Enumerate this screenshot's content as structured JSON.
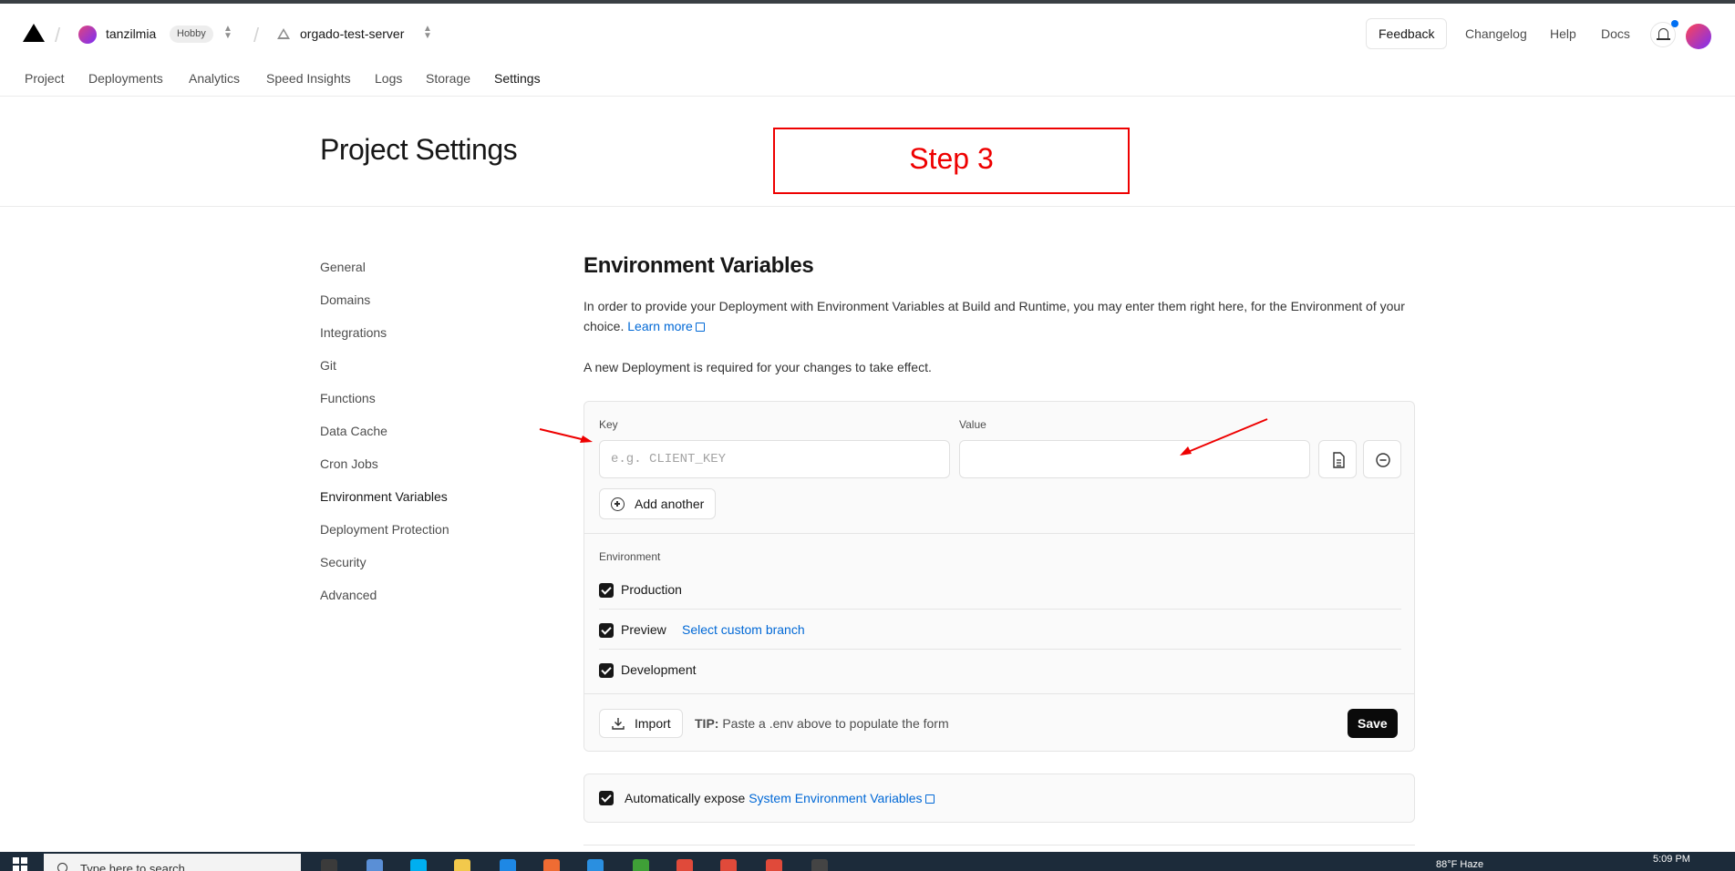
{
  "header": {
    "team_name": "tanzilmia",
    "plan_badge": "Hobby",
    "project_name": "orgado-test-server",
    "feedback_label": "Feedback",
    "changelog_label": "Changelog",
    "help_label": "Help",
    "docs_label": "Docs"
  },
  "tabs": [
    {
      "label": "Project"
    },
    {
      "label": "Deployments"
    },
    {
      "label": "Analytics"
    },
    {
      "label": "Speed Insights"
    },
    {
      "label": "Logs"
    },
    {
      "label": "Storage"
    },
    {
      "label": "Settings",
      "active": true
    }
  ],
  "page": {
    "title": "Project Settings",
    "annotation": "Step 3"
  },
  "sidebar": {
    "items": [
      {
        "label": "General"
      },
      {
        "label": "Domains"
      },
      {
        "label": "Integrations"
      },
      {
        "label": "Git"
      },
      {
        "label": "Functions"
      },
      {
        "label": "Data Cache"
      },
      {
        "label": "Cron Jobs"
      },
      {
        "label": "Environment Variables",
        "active": true
      },
      {
        "label": "Deployment Protection"
      },
      {
        "label": "Security"
      },
      {
        "label": "Advanced"
      }
    ]
  },
  "env": {
    "title": "Environment Variables",
    "description": "In order to provide your Deployment with Environment Variables at Build and Runtime, you may enter them right here, for the Environment of your choice.",
    "learn_more": "Learn more",
    "notice": "A new Deployment is required for your changes to take effect.",
    "key_label": "Key",
    "key_placeholder": "e.g. CLIENT_KEY",
    "key_value": "",
    "value_label": "Value",
    "value_value": "",
    "add_another": "Add another",
    "environment_label": "Environment",
    "environments": [
      {
        "label": "Production",
        "checked": true
      },
      {
        "label": "Preview",
        "checked": true,
        "link": "Select custom branch"
      },
      {
        "label": "Development",
        "checked": true
      }
    ],
    "import_label": "Import",
    "tip_prefix": "TIP:",
    "tip_text": "Paste a .env above to populate the form",
    "save_label": "Save",
    "expose_text": "Automatically expose",
    "expose_link": "System Environment Variables"
  },
  "colors": {
    "accent_link": "#0068d6",
    "annotation_red": "#e00000",
    "primary_button": "#0a0a0a"
  },
  "taskbar": {
    "search_placeholder": "Type here to search",
    "weather": "88°F  Haze",
    "time": "5:09 PM"
  }
}
